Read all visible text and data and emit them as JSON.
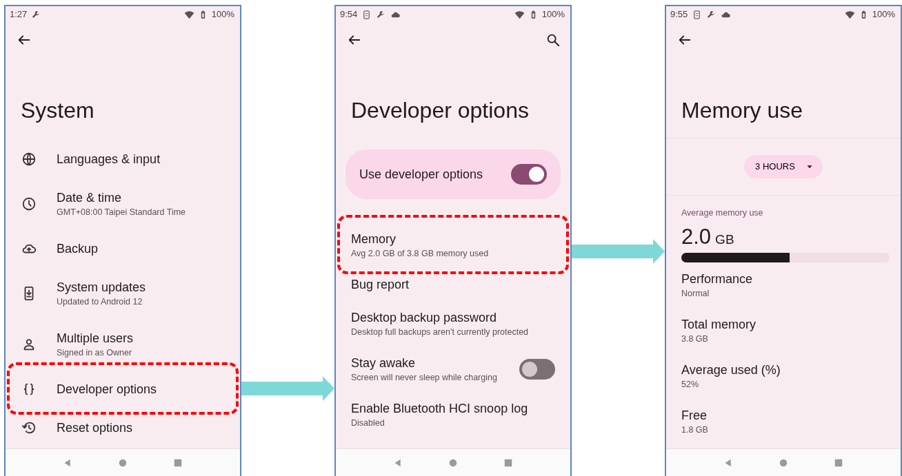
{
  "system_screen": {
    "status_bar": {
      "time": "1:27",
      "battery": "100%"
    },
    "title": "System",
    "items": [
      {
        "title": "Languages & input",
        "highlighted": false
      },
      {
        "title": "Date & time",
        "subtitle": "GMT+08:00 Taipei Standard Time",
        "highlighted": false
      },
      {
        "title": "Backup",
        "highlighted": false
      },
      {
        "title": "System updates",
        "subtitle": "Updated to Android 12",
        "highlighted": false
      },
      {
        "title": "Multiple users",
        "subtitle": "Signed in as Owner",
        "highlighted": false
      },
      {
        "title": "Developer options",
        "highlighted": true
      },
      {
        "title": "Reset options",
        "highlighted": false
      }
    ]
  },
  "developer_screen": {
    "status_bar": {
      "time": "9:54",
      "battery": "100%"
    },
    "title": "Developer options",
    "master_switch": {
      "label": "Use developer options",
      "on": true
    },
    "items": [
      {
        "kind": "plain",
        "title": "Memory",
        "subtitle": "Avg 2.0 GB of 3.8 GB memory used",
        "highlighted": true
      },
      {
        "kind": "plain",
        "title": "Bug report",
        "highlighted": false
      },
      {
        "kind": "plain",
        "title": "Desktop backup password",
        "subtitle": "Desktop full backups aren’t currently protected",
        "highlighted": false
      },
      {
        "kind": "switch",
        "title": "Stay awake",
        "subtitle": "Screen will never sleep while charging",
        "on": false,
        "highlighted": false
      },
      {
        "kind": "plain",
        "title": "Enable Bluetooth HCI snoop log",
        "subtitle": "Disabled",
        "highlighted": false
      }
    ]
  },
  "memory_screen": {
    "status_bar": {
      "time": "9:55",
      "battery": "100%"
    },
    "title": "Memory use",
    "period_dropdown": {
      "value": "3 HOURS"
    },
    "average": {
      "label": "Average memory use",
      "value": "2.0",
      "unit": "GB",
      "level": 0.52
    },
    "stats": [
      {
        "label": "Performance",
        "value": "Normal"
      },
      {
        "label": "Total memory",
        "value": "3.8 GB"
      },
      {
        "label": "Average used (%)",
        "value": "52%"
      },
      {
        "label": "Free",
        "value": "1.8 GB"
      }
    ]
  }
}
